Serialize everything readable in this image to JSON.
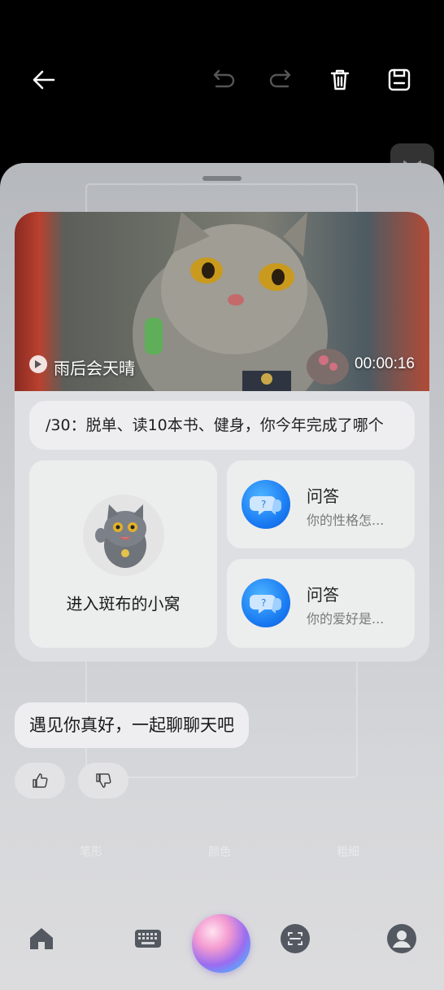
{
  "header": {
    "icons": [
      "back-arrow-icon",
      "undo-icon",
      "redo-icon",
      "trash-icon",
      "save-icon"
    ]
  },
  "video": {
    "title": "雨后会天晴",
    "duration": "00:00:16"
  },
  "marquee": {
    "text": "/30：脱单、读10本书、健身，你今年完成了哪个"
  },
  "tiles": {
    "enter_label": "进入斑布的小窝",
    "qa": [
      {
        "title": "问答",
        "subtitle": "你的性格怎..."
      },
      {
        "title": "问答",
        "subtitle": "你的爱好是..."
      }
    ]
  },
  "chat": {
    "message": "遇见你真好，一起聊聊天吧"
  },
  "faint_tools": {
    "brush": "笔形",
    "color": "颜色",
    "thickness": "粗细"
  },
  "dock": {
    "icons": [
      "home-icon",
      "keyboard-icon",
      "assistant-orb",
      "scan-icon",
      "profile-icon"
    ]
  },
  "colors": {
    "qa_blue": "#1b7df3",
    "sheet_bg": "#c7c9cd"
  }
}
